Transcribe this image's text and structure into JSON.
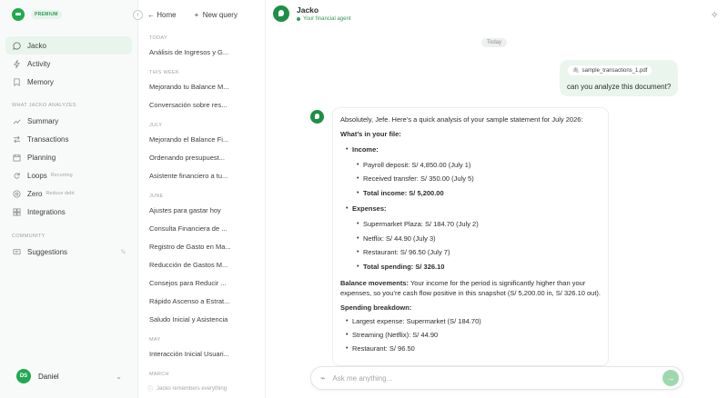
{
  "brand": {
    "badge": "PREMIUM"
  },
  "sidebar": {
    "nav": [
      {
        "label": "Jacko",
        "icon": "chat-icon",
        "active": true
      },
      {
        "label": "Activity",
        "icon": "bolt-icon"
      },
      {
        "label": "Memory",
        "icon": "bookmark-icon"
      }
    ],
    "analyzes_label": "WHAT JACKO ANALYZES",
    "analyzes": [
      {
        "label": "Summary",
        "icon": "trend-icon",
        "sub": ""
      },
      {
        "label": "Transactions",
        "icon": "swap-icon",
        "sub": ""
      },
      {
        "label": "Planning",
        "icon": "calendar-icon",
        "sub": ""
      },
      {
        "label": "Loops",
        "icon": "refresh-icon",
        "sub": "Recurring"
      },
      {
        "label": "Zero",
        "icon": "target-icon",
        "sub": "Reduce debt"
      },
      {
        "label": "Integrations",
        "icon": "grid-icon",
        "sub": ""
      }
    ],
    "community_label": "COMMUNITY",
    "community": [
      {
        "label": "Suggestions",
        "icon": "message-icon"
      }
    ],
    "user": {
      "initials": "DS",
      "name": "Daniel"
    }
  },
  "history": {
    "home": "Home",
    "new_query": "New query",
    "groups": [
      {
        "label": "TODAY",
        "items": [
          "Análisis de Ingresos y G..."
        ]
      },
      {
        "label": "THIS WEEK",
        "items": [
          "Mejorando tu Balance M...",
          "Conversación sobre res..."
        ]
      },
      {
        "label": "JULY",
        "items": [
          "Mejorando el Balance Fi...",
          "Ordenando presupuest...",
          "Asistente financiero a tu..."
        ]
      },
      {
        "label": "JUNE",
        "items": [
          "Ajustes para gastar hoy",
          "Consulta Financiera de ...",
          "Registro de Gasto en Ma...",
          "Reducción de Gastos M...",
          "Consejos para Reducir ...",
          "Rápido Ascenso a Estrat...",
          "Saludo Inicial y Asistencia"
        ]
      },
      {
        "label": "MAY",
        "items": [
          "Interacción Inicial Usuari..."
        ]
      },
      {
        "label": "MARCH",
        "items": []
      }
    ],
    "footer": "Jacko remembers everything"
  },
  "chat": {
    "agent_name": "Jacko",
    "agent_role": "Your financial agent",
    "day": "Today",
    "user_file": "sample_transactions_1.pdf",
    "user_text": "can you analyze this document?",
    "reply": {
      "intro": "Absolutely, Jefe. Here’s a quick analysis of your sample statement for July 2026:",
      "whats_in": "What’s in your file:",
      "income_label": "Income:",
      "income": [
        "Payroll deposit: S/ 4,850.00 (July 1)",
        "Received transfer: S/ 350.00 (July 5)"
      ],
      "income_total": "Total income: S/ 5,200.00",
      "expenses_label": "Expenses:",
      "expenses": [
        "Supermarket Plaza: S/ 184.70 (July 2)",
        "Netflix: S/ 44.90 (July 3)",
        "Restaurant: S/ 96.50 (July 7)"
      ],
      "expenses_total": "Total spending: S/ 326.10",
      "balance_label": "Balance movements:",
      "balance_text": " Your income for the period is significantly higher than your expenses, so you’re cash flow positive in this snapshot (S/ 5,200.00 in, S/ 326.10 out).",
      "breakdown_label": "Spending breakdown:",
      "breakdown": [
        "Largest expense: Supermarket (S/ 184.70)",
        "Streaming (Netflix): S/ 44.90",
        "Restaurant: S/ 96.50"
      ]
    },
    "input_placeholder": "Ask me anything..."
  }
}
